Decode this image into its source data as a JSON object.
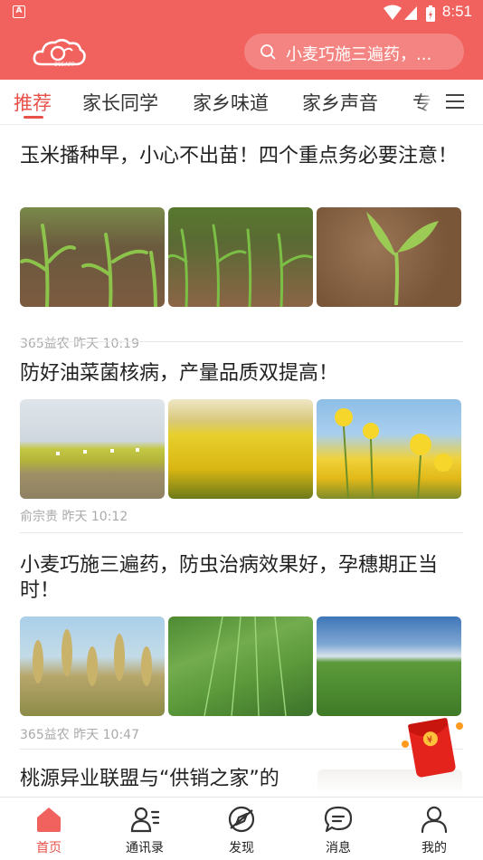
{
  "status_bar": {
    "time": "8:51"
  },
  "header": {
    "logo_text": "365APP",
    "search": {
      "placeholder": "小麦巧施三遍药，..."
    }
  },
  "tabs": [
    {
      "label": "推荐",
      "active": true
    },
    {
      "label": "家长同学"
    },
    {
      "label": "家乡味道"
    },
    {
      "label": "家乡声音"
    },
    {
      "label": "专"
    }
  ],
  "articles": [
    {
      "title": "玉米播种早，小心不出苗！四个重点务必要注意！",
      "source": "365益农",
      "time": "昨天 10:19"
    },
    {
      "title": "防好油菜菌核病，产量品质双提高！",
      "source": "俞宗贵",
      "time": "昨天 10:12"
    },
    {
      "title": "小麦巧施三遍药，防虫治病效果好，孕穗期正当时！",
      "source": "365益农",
      "time": "昨天 10:47"
    },
    {
      "title": "桃源异业联盟与“供销之家”的"
    }
  ],
  "bottom_nav": [
    {
      "label": "首页",
      "icon": "home-icon",
      "active": true
    },
    {
      "label": "通讯录",
      "icon": "contacts-icon"
    },
    {
      "label": "发现",
      "icon": "discover-icon"
    },
    {
      "label": "消息",
      "icon": "message-icon"
    },
    {
      "label": "我的",
      "icon": "profile-icon"
    }
  ],
  "colors": {
    "brand": "#f1625e",
    "accent": "#e8504a"
  }
}
